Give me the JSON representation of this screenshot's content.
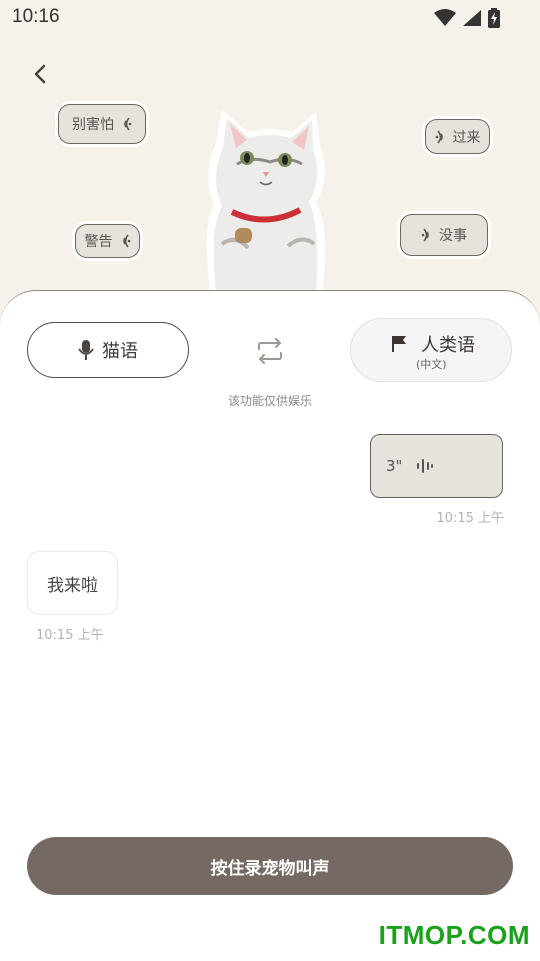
{
  "status_bar": {
    "time": "10:16",
    "icons": [
      "wifi-icon",
      "signal-icon",
      "battery-charging-icon"
    ]
  },
  "hero": {
    "back_icon": "chevron-left-icon",
    "bubbles": [
      {
        "label": "别害怕",
        "icon": "sound-waves-icon"
      },
      {
        "label": "过来",
        "icon": "sound-waves-icon"
      },
      {
        "label": "警告",
        "icon": "sound-waves-icon"
      },
      {
        "label": "没事",
        "icon": "sound-waves-icon"
      }
    ]
  },
  "translator": {
    "cat_lang": "猫语",
    "human_lang": "人类语",
    "human_lang_sub": "(中文)",
    "swap_icon": "swap-icon",
    "disclaimer": "该功能仅供娱乐"
  },
  "messages": [
    {
      "side": "right",
      "duration": "3\"",
      "time": "10:15 上午"
    },
    {
      "side": "left",
      "text": "我来啦",
      "time": "10:15 上午"
    }
  ],
  "record_button": "按住录宠物叫声",
  "watermark": "ITMOP.COM",
  "colors": {
    "background": "#f6f2ea",
    "panel": "#ffffff",
    "record_button": "#756a63",
    "bubble": "#e6e3dd",
    "watermark": "#1aa11a"
  }
}
